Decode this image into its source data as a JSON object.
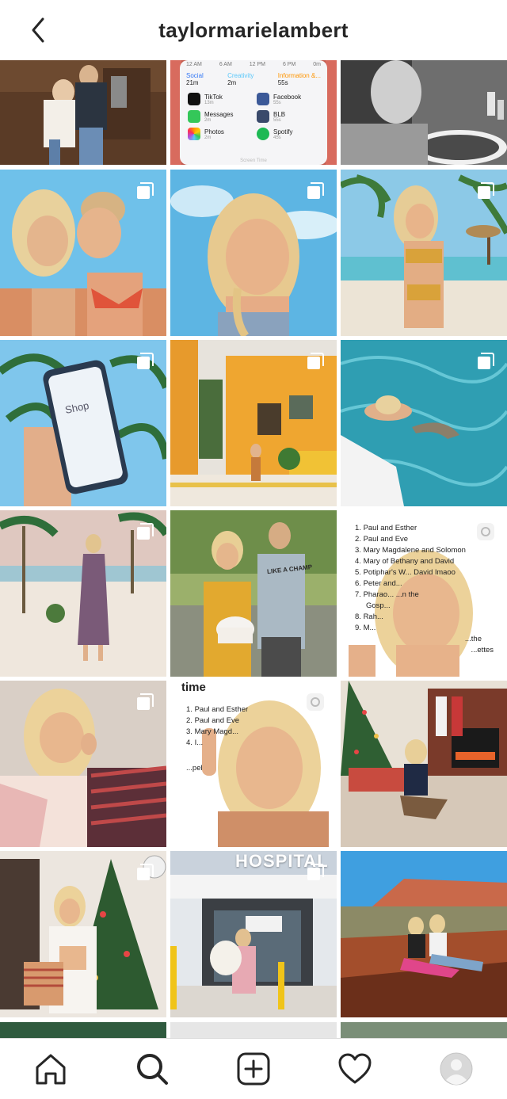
{
  "header": {
    "username": "taylormarielambert",
    "back_icon": "chevron-left-icon"
  },
  "posts": [
    {
      "id": "post-1",
      "scene": "couple-shop",
      "multi": false
    },
    {
      "id": "post-2",
      "scene": "screen-time",
      "multi": false,
      "screen_time": {
        "times": [
          "12 AM",
          "6 AM",
          "12 PM",
          "6 PM",
          "0m"
        ],
        "categories": [
          {
            "label": "Social",
            "value": "21m"
          },
          {
            "label": "Creativity",
            "value": "2m"
          },
          {
            "label": "Information &...",
            "value": "55s"
          }
        ],
        "apps": [
          {
            "name": "TikTok",
            "time": "13m"
          },
          {
            "name": "Facebook",
            "time": "55s"
          },
          {
            "name": "Messages",
            "time": "2m"
          },
          {
            "name": "BLB",
            "time": "55s"
          },
          {
            "name": "Photos",
            "time": "2m"
          },
          {
            "name": "Spotify",
            "time": "45s"
          }
        ],
        "footer": "Screen Time"
      }
    },
    {
      "id": "post-3",
      "scene": "bw-bath",
      "multi": false
    },
    {
      "id": "post-4",
      "scene": "two-girls-beach",
      "multi": true
    },
    {
      "id": "post-5",
      "scene": "selfie-sky",
      "multi": true
    },
    {
      "id": "post-6",
      "scene": "bikini-beach",
      "multi": true
    },
    {
      "id": "post-7",
      "scene": "phone-palms",
      "multi": true,
      "phone_text": "Shop"
    },
    {
      "id": "post-8",
      "scene": "yellow-building",
      "multi": true
    },
    {
      "id": "post-9",
      "scene": "shark-water",
      "multi": true
    },
    {
      "id": "post-10",
      "scene": "dress-beach",
      "multi": true
    },
    {
      "id": "post-11",
      "scene": "couple-cake",
      "multi": false,
      "shirt_text": "LIKE A CHAMP"
    },
    {
      "id": "post-12",
      "scene": "list-selfie",
      "multi": false,
      "list_items": [
        "Paul and Esther",
        "Paul and Eve",
        "Mary Magdalene and Solomon",
        "Mary of Bethany and David",
        "Potiphar's W... David lmaoo",
        "Peter and...",
        "Pharao... ...n the",
        "Gosp...",
        "Rah...",
        "M...",
        "...the",
        "...ettes"
      ]
    },
    {
      "id": "post-13",
      "scene": "pink-sweater",
      "multi": true
    },
    {
      "id": "post-14",
      "scene": "time-list",
      "multi": false,
      "time_title": "time",
      "list_items": [
        "Paul and Esther",
        "Paul and Eve",
        "Mary Magd...",
        "I...",
        "...pel"
      ]
    },
    {
      "id": "post-15",
      "scene": "xmas-fireplace",
      "multi": false
    },
    {
      "id": "post-16",
      "scene": "xmas-tree-bag",
      "multi": true
    },
    {
      "id": "post-17",
      "scene": "hospital",
      "multi": true,
      "sign_text": "HOSPITAL"
    },
    {
      "id": "post-18",
      "scene": "canyon",
      "multi": false
    }
  ],
  "tabbar": {
    "items": [
      {
        "name": "home",
        "icon": "home-icon"
      },
      {
        "name": "search",
        "icon": "search-icon",
        "active": true
      },
      {
        "name": "new-post",
        "icon": "plus-square-icon"
      },
      {
        "name": "activity",
        "icon": "heart-icon"
      },
      {
        "name": "profile",
        "icon": "avatar-icon"
      }
    ]
  },
  "colors": {
    "text": "#262626",
    "divider": "#dbdbdb",
    "sky": "#6fc1ea",
    "sea": "#3fb3c8",
    "sand": "#e9dfd2"
  }
}
